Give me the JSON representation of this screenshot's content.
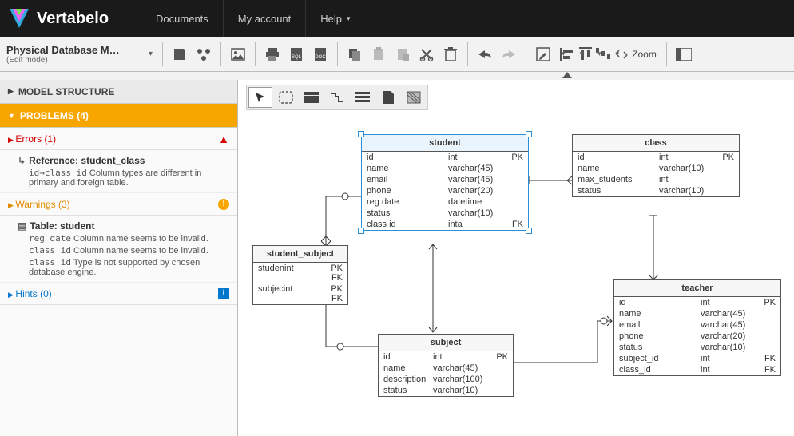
{
  "brand": "Vertabelo",
  "nav": {
    "documents": "Documents",
    "account": "My account",
    "help": "Help"
  },
  "doc": {
    "title": "Physical Database M…",
    "mode": "(Edit mode)"
  },
  "zoom": "Zoom",
  "sidebar": {
    "model_structure": "MODEL STRUCTURE",
    "problems": "PROBLEMS (4)",
    "errors_hdr": "Errors (1)",
    "warnings_hdr": "Warnings (3)",
    "hints_hdr": "Hints (0)",
    "error_entry": {
      "title": "Reference: student_class",
      "code": "id→class id",
      "text": "Column types are different in primary and foreign table."
    },
    "warn_entry": {
      "title": "Table: student",
      "w1_code": "reg date",
      "w1_text": "Column name seems to be invalid.",
      "w2_code": "class id",
      "w2_text": "Column name seems to be invalid.",
      "w3_code": "class id",
      "w3_text": "Type is not supported by chosen database engine."
    }
  },
  "tables": {
    "student": {
      "name": "student",
      "cols": [
        [
          "id",
          "int",
          "PK"
        ],
        [
          "name",
          "varchar(45)",
          ""
        ],
        [
          "email",
          "varchar(45)",
          ""
        ],
        [
          "phone",
          "varchar(20)",
          ""
        ],
        [
          "reg date",
          "datetime",
          ""
        ],
        [
          "status",
          "varchar(10)",
          ""
        ],
        [
          "class id",
          "inta",
          "FK"
        ]
      ]
    },
    "class": {
      "name": "class",
      "cols": [
        [
          "id",
          "int",
          "PK"
        ],
        [
          "name",
          "varchar(10)",
          ""
        ],
        [
          "max_students",
          "int",
          ""
        ],
        [
          "status",
          "varchar(10)",
          ""
        ]
      ]
    },
    "student_subject": {
      "name": "student_subject",
      "cols": [
        [
          "studen",
          "int",
          "PK FK"
        ],
        [
          "subjec",
          "int",
          "PK FK"
        ]
      ]
    },
    "subject": {
      "name": "subject",
      "cols": [
        [
          "id",
          "int",
          "PK"
        ],
        [
          "name",
          "varchar(45)",
          ""
        ],
        [
          "description",
          "varchar(100)",
          ""
        ],
        [
          "status",
          "varchar(10)",
          ""
        ]
      ]
    },
    "teacher": {
      "name": "teacher",
      "cols": [
        [
          "id",
          "int",
          "PK"
        ],
        [
          "name",
          "varchar(45)",
          ""
        ],
        [
          "email",
          "varchar(45)",
          ""
        ],
        [
          "phone",
          "varchar(20)",
          ""
        ],
        [
          "status",
          "varchar(10)",
          ""
        ],
        [
          "subject_id",
          "int",
          "FK"
        ],
        [
          "class_id",
          "int",
          "FK"
        ]
      ]
    }
  }
}
